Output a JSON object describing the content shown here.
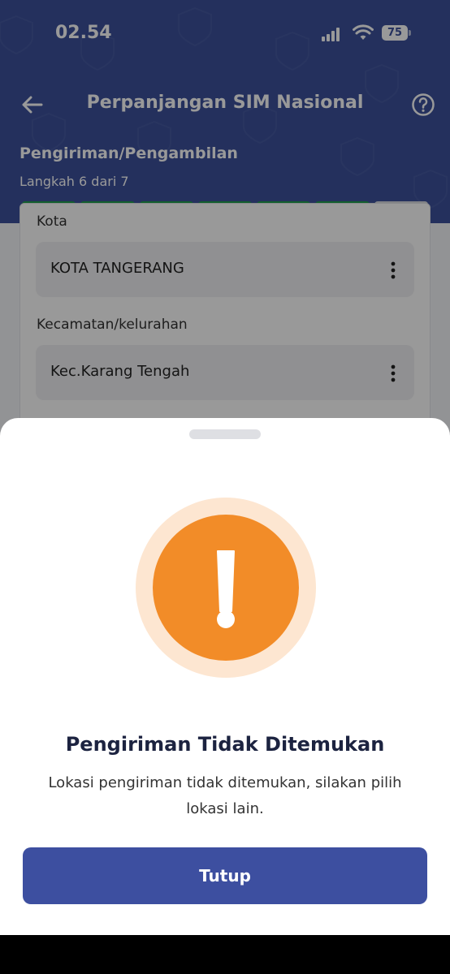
{
  "status_bar": {
    "time": "02.54",
    "battery": "75"
  },
  "nav": {
    "title": "Perpanjangan SIM Nasional",
    "back_icon": "arrow-left-icon",
    "help_icon": "question-circle-icon"
  },
  "step": {
    "title": "Pengiriman/Pengambilan",
    "subtitle": "Langkah 6 dari 7",
    "current": 6,
    "total": 7
  },
  "form": {
    "fields": [
      {
        "label": "Kota",
        "value": "KOTA TANGERANG"
      },
      {
        "label": "Kecamatan/kelurahan",
        "value": "Kec.Karang Tengah"
      }
    ]
  },
  "sheet": {
    "icon": "exclamation-alert-icon",
    "title": "Pengiriman Tidak Ditemukan",
    "message": "Lokasi pengiriman tidak ditemukan, silakan pilih lokasi lain.",
    "button_label": "Tutup"
  },
  "colors": {
    "header": "#3c519c",
    "progress_done": "#1f9d4b",
    "progress_pending": "#d9dbe0",
    "alert": "#f28c28",
    "alert_halo": "#fde6d1",
    "button": "#3d4fa0"
  }
}
